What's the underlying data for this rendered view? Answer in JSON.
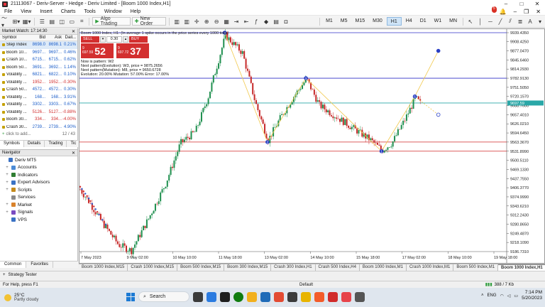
{
  "window": {
    "title": "21113067 - Deriv-Server - Hedge - Deriv Limited - [Boom 1000 Index,H1]"
  },
  "menu": {
    "items": [
      "File",
      "View",
      "Insert",
      "Charts",
      "Tools",
      "Window",
      "Help"
    ],
    "notifications": "5"
  },
  "toolbar": {
    "algo_trading": "Algo Trading",
    "new_order": "New Order",
    "timeframes": [
      "M1",
      "M5",
      "M15",
      "M30",
      "H1",
      "H4",
      "D1",
      "W1",
      "MN"
    ],
    "active_timeframe": "H1"
  },
  "market_watch": {
    "title": "Market Watch: 17:14:30",
    "columns": [
      "Symbol",
      "Bid",
      "Ask",
      "Dail..."
    ],
    "rows": [
      {
        "symbol": "Step Index",
        "bid": "8698.0",
        "ask": "8698.1",
        "daily": "0.21%",
        "dir": "pos",
        "selected": true
      },
      {
        "symbol": "Boom 10...",
        "bid": "9697...",
        "ask": "9697...",
        "daily": "0.46%",
        "dir": "pos"
      },
      {
        "symbol": "Crash 10...",
        "bid": "6715...",
        "ask": "6715...",
        "daily": "0.62%",
        "dir": "pos"
      },
      {
        "symbol": "Boom 50...",
        "bid": "3691...",
        "ask": "3692...",
        "daily": "1.14%",
        "dir": "pos"
      },
      {
        "symbol": "Volatility ...",
        "bid": "6821...",
        "ask": "6822...",
        "daily": "0.10%",
        "dir": "pos"
      },
      {
        "symbol": "Volatility ...",
        "bid": "1952...",
        "ask": "1952...",
        "daily": "-0.30%",
        "dir": "neg"
      },
      {
        "symbol": "Crash 50...",
        "bid": "4572...",
        "ask": "4572...",
        "daily": "0.30%",
        "dir": "pos"
      },
      {
        "symbol": "Volatility ...",
        "bid": "168...",
        "ask": "168...",
        "daily": "3.91%",
        "dir": "pos"
      },
      {
        "symbol": "Volatility ...",
        "bid": "3302...",
        "ask": "3303...",
        "daily": "0.67%",
        "dir": "pos"
      },
      {
        "symbol": "Volatility ...",
        "bid": "5126...",
        "ask": "5127...",
        "daily": "-0.88%",
        "dir": "neg"
      },
      {
        "symbol": "Boom 30...",
        "bid": "334...",
        "ask": "334...",
        "daily": "-4.00%",
        "dir": "neg"
      },
      {
        "symbol": "Crash 30...",
        "bid": "2739...",
        "ask": "2739...",
        "daily": "4.90%",
        "dir": "pos"
      }
    ],
    "add_placeholder": "click to add...",
    "count": "12 / 43",
    "tabs": [
      "Symbols",
      "Details",
      "Trading",
      "Tic"
    ]
  },
  "navigator": {
    "title": "Navigator",
    "items": [
      {
        "label": "Deriv MT5",
        "color": "#3a72c4",
        "exp": "",
        "indent": 0
      },
      {
        "label": "Accounts",
        "color": "#4b8bd6",
        "exp": "+",
        "indent": 1
      },
      {
        "label": "Indicators",
        "color": "#2f7d32",
        "exp": "+",
        "indent": 1
      },
      {
        "label": "Expert Advisors",
        "color": "#3a72c4",
        "exp": "+",
        "indent": 1
      },
      {
        "label": "Scripts",
        "color": "#c48a1c",
        "exp": "+",
        "indent": 1
      },
      {
        "label": "Services",
        "color": "#8a8a8a",
        "exp": "",
        "indent": 1
      },
      {
        "label": "Market",
        "color": "#d9822b",
        "exp": "+",
        "indent": 1
      },
      {
        "label": "Signals",
        "color": "#7a4cc2",
        "exp": "+",
        "indent": 1
      },
      {
        "label": "VPS",
        "color": "#3a72c4",
        "exp": "",
        "indent": 1
      }
    ],
    "tabs": [
      "Common",
      "Favorites"
    ]
  },
  "chart_panel": {
    "header": "Boom 1000 Index, H1:  (In average 1 spike occurs in the price series every 1000 ticks)",
    "sell_label": "SELL",
    "buy_label": "BUY",
    "lot": "0.30",
    "sell_price_small": "9\n697.59",
    "sell_price_big": "52",
    "buy_price_small": "9\n697.72",
    "buy_price_big": "37",
    "info_lines": [
      "Now is pattern: W2",
      "Next pattern(Evolution): W3, price = 9875.2656",
      "Next pattern(Mutation): M8, price = 9650.6728",
      "Evolution: 20.00% Mutation: 57.00% Error: 17.00%"
    ]
  },
  "chart_data": {
    "type": "candlestick",
    "symbol": "Boom 1000 Index",
    "timeframe": "H1",
    "price_axis": [
      "9939.4350",
      "9908.4250",
      "9877.0470",
      "9845.6460",
      "9814.2930",
      "9782.9130",
      "9751.5050",
      "9720.1570",
      "9688.7600",
      "9657.4010",
      "9626.0210",
      "9594.6450",
      "9563.3670",
      "9531.8990",
      "9500.5110",
      "9469.1330",
      "9437.7550",
      "9406.3770",
      "9374.9990",
      "9343.6210",
      "9312.2430",
      "9280.8650",
      "9249.4870",
      "9218.1090",
      "9186.7310"
    ],
    "time_axis": [
      "7 May 2023",
      "9 May 02:00",
      "10 May 10:00",
      "11 May 18:00",
      "13 May 02:00",
      "14 May 10:00",
      "15 May 18:00",
      "17 May 02:00",
      "18 May 10:00",
      "19 May 18:00"
    ],
    "current_price_label": "9697.59",
    "horizontal_levels": [
      {
        "price": 9939.4,
        "color": "#3030c8"
      },
      {
        "price": 9782.9,
        "color": "#3030c8"
      },
      {
        "price": 9697.6,
        "color": "#2aa7a7"
      },
      {
        "price": 9563.4,
        "color": "#d12b2b"
      },
      {
        "price": 9531.9,
        "color": "#d12b2b"
      }
    ],
    "pattern_points": [
      {
        "label": "0",
        "t": 0.34,
        "price": 9939.4
      },
      {
        "label": "2",
        "t": 0.44,
        "price": 9563.4
      },
      {
        "label": "3",
        "t": 0.53,
        "price": 9782.9
      },
      {
        "label": "1",
        "t": 0.707,
        "price": 9531.9
      },
      {
        "label": "5",
        "t": 0.785,
        "price": 9720.2
      }
    ],
    "projection_points": [
      {
        "t": 0.84,
        "price": 9877.0
      },
      {
        "t": 0.84,
        "price": 9657.4
      }
    ]
  },
  "chart_tabs": {
    "items": [
      "Boom 1000 Index,M15",
      "Crash 1000 Index,M15",
      "Boom 500 Index,M15",
      "Boom 300 Index,M15",
      "Crash 300 Index,H1",
      "Crash 500 Index,H4",
      "Boom 1000 Index,M1",
      "Crash 1000 Index,M1",
      "Boom 500 Index,M1",
      "Boom 1000 Index,H1"
    ],
    "active": "Boom 1000 Index,H1"
  },
  "strategy_tester": {
    "label": "Strategy Tester"
  },
  "status": {
    "help": "For Help, press F1",
    "profile": "Default",
    "traffic": "388 / 7 Kb"
  },
  "taskbar": {
    "temp": "25°C",
    "weather": "Partly cloudy",
    "search": "Search",
    "lang": "ENG",
    "time": "7:14 PM",
    "date": "5/20/2023"
  }
}
